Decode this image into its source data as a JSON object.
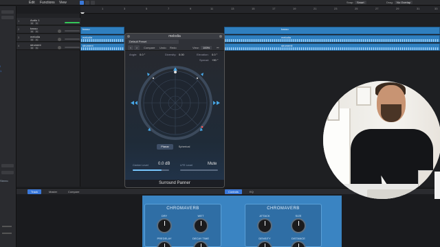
{
  "menubar": {
    "edit": "Edit",
    "functions": "Functions",
    "view": "View",
    "snap_label": "Snap:",
    "snap_value": "Smart",
    "drag_label": "Drag:",
    "drag_value": "No Overlap"
  },
  "ruler": {
    "ticks": [
      "1",
      "3",
      "5",
      "7",
      "9",
      "11",
      "13",
      "15",
      "17",
      "19",
      "21",
      "23",
      "25",
      "27",
      "29",
      "31",
      "33"
    ]
  },
  "inspector": {
    "tag1": "l",
    "tag2": "1",
    "tag3": "Stereo"
  },
  "tracks": [
    {
      "num": "1",
      "name": "Audio 1"
    },
    {
      "num": "2",
      "name": "basso"
    },
    {
      "num": "3",
      "name": "melodia"
    },
    {
      "num": "4",
      "name": "strument"
    }
  ],
  "track_buttons": {
    "mute": "M",
    "solo": "S"
  },
  "regions": [
    {
      "label": "basso",
      "label2": "basso"
    },
    {
      "label": "melodia",
      "label2": "melodia"
    },
    {
      "label": "strument",
      "label2": "strumenti"
    }
  ],
  "panner": {
    "title": "melodia",
    "preset": "Default Preset",
    "nav_prev": "<",
    "nav_next": ">",
    "tools": {
      "compare": "Compare",
      "undo": "Undo",
      "redo": "Redo"
    },
    "view_label": "View:",
    "view_value": "100%",
    "angle_label": "Angle:",
    "angle_value": "0.0 °",
    "diversity_label": "Diversity:",
    "diversity_value": "0.00",
    "elevation_label": "Elevation:",
    "elevation_value": "0.0 °",
    "spread_label": "Spread:",
    "spread_value": "+90 °",
    "mode_planar": "Planar",
    "mode_spherical": "Spherical",
    "center_level_label": "Center Level",
    "center_level_value": "0.0 dB",
    "lfe_level_label": "LFE Level",
    "lfe_level_value": "Mute",
    "footer": "Surround Panner"
  },
  "bottom_tabs": {
    "track": "Track",
    "master": "Master",
    "compare": "Compare",
    "controls": "Controls",
    "eq": "EQ"
  },
  "chromaverb": [
    {
      "title": "CHROMAVERB",
      "k1": "DRY",
      "k2": "WET",
      "k3": "PREDELAY",
      "k4": "DECAY TIME"
    },
    {
      "title": "CHROMAVERB",
      "k1": "ATTACK",
      "k2": "SIZE",
      "k3": "DENSITY",
      "k4": "DISTANCE"
    }
  ],
  "colors": {
    "accent_blue": "#3a78d8",
    "region_blue": "#2f7fbf",
    "plugin_blue": "#3a84c2",
    "green_volume": "#34c759"
  }
}
